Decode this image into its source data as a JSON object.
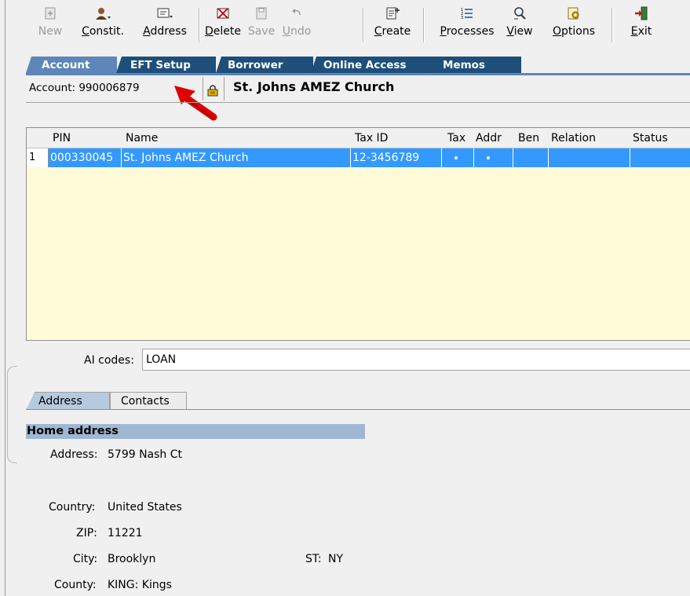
{
  "toolbar": {
    "buttons": [
      {
        "label": "New",
        "icon": "new-icon",
        "disabled": true
      },
      {
        "label": "Constit.",
        "icon": "constituent-icon",
        "disabled": false
      },
      {
        "label": "Address",
        "icon": "address-icon",
        "disabled": false
      },
      {
        "label": "Delete",
        "icon": "delete-icon",
        "disabled": false
      },
      {
        "label": "Save",
        "icon": "save-icon",
        "disabled": true
      },
      {
        "label": "Undo",
        "icon": "undo-icon",
        "disabled": true
      },
      {
        "label": "Create",
        "icon": "create-icon",
        "disabled": false
      },
      {
        "label": "Processes",
        "icon": "processes-icon",
        "disabled": false
      },
      {
        "label": "View",
        "icon": "view-icon",
        "disabled": false
      },
      {
        "label": "Options",
        "icon": "options-icon",
        "disabled": false
      },
      {
        "label": "Exit",
        "icon": "exit-icon",
        "disabled": false
      }
    ]
  },
  "tabs": [
    {
      "label": "Account",
      "active": true
    },
    {
      "label": "EFT Setup",
      "active": false
    },
    {
      "label": "Borrower",
      "active": false
    },
    {
      "label": "Online Access",
      "active": false
    },
    {
      "label": "Memos",
      "active": false
    }
  ],
  "account": {
    "label": "Account: 990006879",
    "name": "St. Johns AMEZ Church"
  },
  "grid": {
    "columns": [
      "PIN",
      "Name",
      "Tax ID",
      "Tax",
      "Addr",
      "Ben",
      "Relation",
      "Status"
    ],
    "rows": [
      {
        "num": "1",
        "pin": "000330045",
        "name": "St. Johns AMEZ Church",
        "tax_id": "12-3456789",
        "tax": true,
        "addr": true,
        "ben": false,
        "relation": "",
        "status": ""
      }
    ]
  },
  "ai_codes": {
    "label": "AI codes:",
    "value": "LOAN"
  },
  "lower_tabs": [
    {
      "label": "Address",
      "active": true
    },
    {
      "label": "Contacts",
      "active": false
    }
  ],
  "home_address": {
    "header": "Home address",
    "address_label": "Address:",
    "address": "5799 Nash Ct",
    "country_label": "Country:",
    "country": "United States",
    "zip_label": "ZIP:",
    "zip": "11221",
    "city_label": "City:",
    "city": "Brooklyn",
    "st_label": "ST:",
    "st": "NY",
    "county_label": "County:",
    "county": "KING: Kings"
  },
  "colors": {
    "tab_active": "#5e86b8",
    "tab_inactive": "#1d4f7a",
    "grid_background": "#fffbd9",
    "row_selected": "#3399ff",
    "section_header": "#a0b7d2",
    "arrow": "#e00000"
  }
}
